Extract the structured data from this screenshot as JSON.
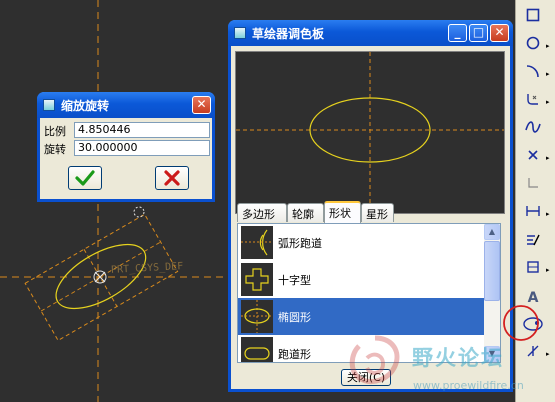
{
  "canvas": {
    "sketch_label": "PRT_CSYS_DEF"
  },
  "scale_dialog": {
    "title": "缩放旋转",
    "fields": [
      {
        "label": "比例",
        "value": "4.850446"
      },
      {
        "label": "旋转",
        "value": "30.000000"
      }
    ],
    "ok_icon": "checkmark-icon",
    "cancel_icon": "x-icon"
  },
  "palette": {
    "title": "草绘器调色板",
    "tabs": [
      "多边形",
      "轮廓",
      "形状",
      "星形"
    ],
    "active_tab": "形状",
    "items": [
      {
        "label": "弧形跑道",
        "icon": "arc-track-icon"
      },
      {
        "label": "十字型",
        "icon": "cross-shape-icon"
      },
      {
        "label": "椭圆形",
        "icon": "ellipse-shape-icon"
      },
      {
        "label": "跑道形",
        "icon": "racetrack-icon"
      }
    ],
    "selected_item": "椭圆形",
    "close_label": "关闭(C)",
    "window_buttons": [
      "minimize-icon",
      "maximize-icon",
      "close-icon"
    ]
  },
  "toolbar": {
    "tools": [
      "rectangle-icon",
      "circle-icon",
      "arc-icon",
      "fillet-icon",
      "spline-icon",
      "point-icon",
      "coordinate-system-icon",
      "dimension-icon",
      "modify-icon",
      "constraint-icon",
      "text-icon",
      "palette-icon",
      "trim-icon"
    ]
  },
  "watermark": {
    "title": "野火论坛",
    "url": "www.proewildfire.cn"
  },
  "colors": {
    "canvas": "#2f2f2f",
    "sketch": "#e6d21e",
    "centerline": "#d88a1c",
    "selection": "#316ac5",
    "titlebar": "#0a50cf",
    "highlight_circle": "#d42020"
  }
}
